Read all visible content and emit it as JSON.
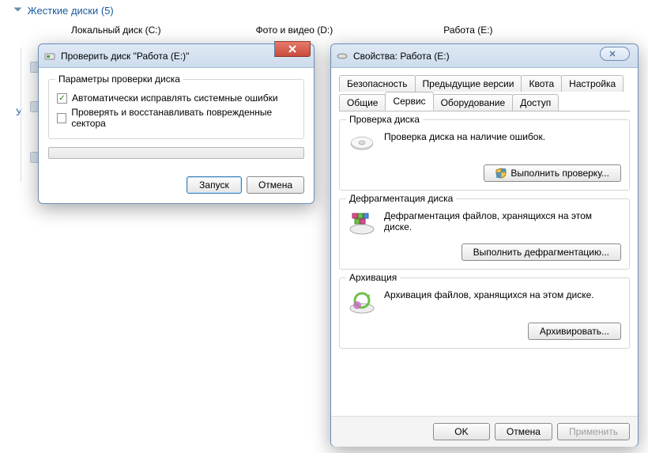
{
  "explorer": {
    "category": "Жесткие диски (5)",
    "drives": [
      {
        "label": "Локальный диск (C:)"
      },
      {
        "label": "Фото и видео (D:)"
      },
      {
        "label": "Работа (E:)"
      }
    ],
    "collapsed_group_prefix": "У"
  },
  "check_dialog": {
    "title": "Проверить диск \"Работа (E:)\"",
    "group_title": "Параметры проверки диска",
    "cb_auto_fix": {
      "label": "Автоматически исправлять системные ошибки",
      "checked": true
    },
    "cb_scan_recover": {
      "label": "Проверять и восстанавливать поврежденные сектора",
      "checked": false
    },
    "start_btn": "Запуск",
    "cancel_btn": "Отмена"
  },
  "properties": {
    "title": "Свойства: Работа (E:)",
    "tabs_row1": [
      "Безопасность",
      "Предыдущие версии",
      "Квота",
      "Настройка"
    ],
    "tabs_row2": [
      "Общие",
      "Сервис",
      "Оборудование",
      "Доступ"
    ],
    "active_tab": "Сервис",
    "sections": {
      "check": {
        "legend": "Проверка диска",
        "text": "Проверка диска на наличие ошибок.",
        "button": "Выполнить проверку..."
      },
      "defrag": {
        "legend": "Дефрагментация диска",
        "text": "Дефрагментация файлов, хранящихся на этом диске.",
        "button": "Выполнить дефрагментацию..."
      },
      "backup": {
        "legend": "Архивация",
        "text": "Архивация файлов, хранящихся на этом диске.",
        "button": "Архивировать..."
      }
    },
    "ok_btn": "OK",
    "cancel_btn": "Отмена",
    "apply_btn": "Применить"
  }
}
